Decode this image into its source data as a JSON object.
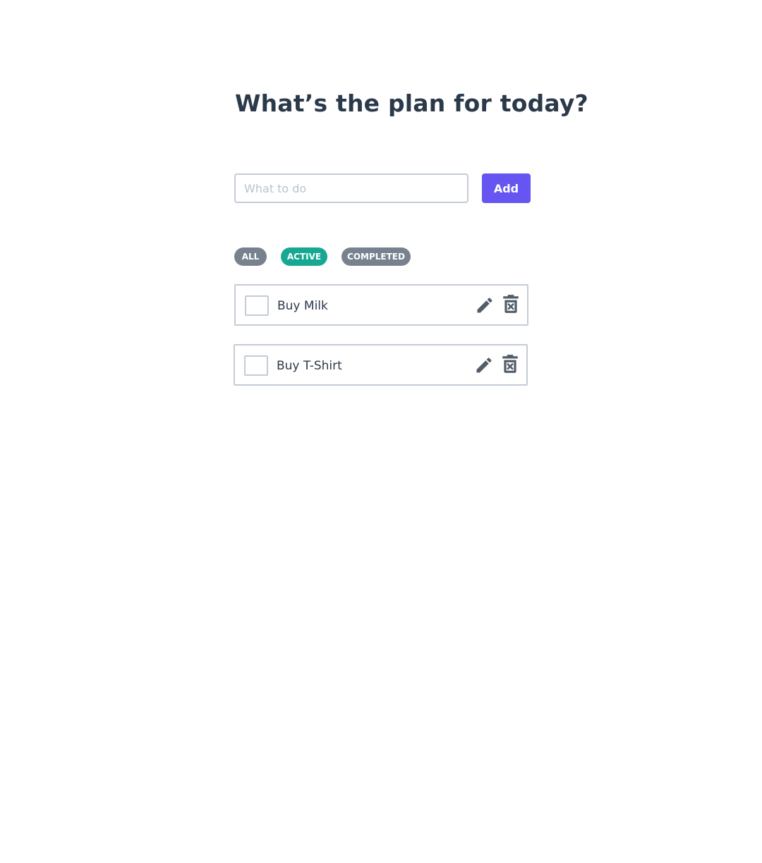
{
  "header": {
    "title": "What’s the plan for today?"
  },
  "form": {
    "input_value": "",
    "input_placeholder": "What to do",
    "add_label": "Add",
    "accent_color": "#6655f0"
  },
  "filters": {
    "items": [
      {
        "label": "ALL",
        "selected": false
      },
      {
        "label": "ACTIVE",
        "selected": true
      },
      {
        "label": "COMPLETED",
        "selected": false
      }
    ],
    "active_color": "#17a893",
    "inactive_color": "#78828f"
  },
  "todos": [
    {
      "text": "Buy Milk",
      "completed": false,
      "edit_icon": "pencil-icon",
      "delete_icon": "trash-x-icon"
    },
    {
      "text": "Buy T-Shirt",
      "completed": false,
      "edit_icon": "pencil-icon",
      "delete_icon": "trash-x-icon"
    }
  ]
}
